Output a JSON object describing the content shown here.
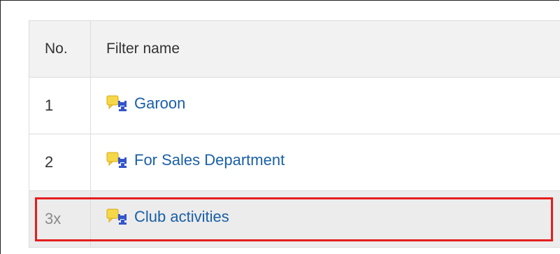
{
  "table": {
    "headers": {
      "no": "No.",
      "filter_name": "Filter name"
    },
    "rows": [
      {
        "no": "1",
        "name": "Garoon",
        "selected": false
      },
      {
        "no": "2",
        "name": "For Sales Department",
        "selected": false
      },
      {
        "no": "3x",
        "name": "Club activities",
        "selected": true
      }
    ]
  },
  "icons": {
    "filter": "filter-rule-icon"
  },
  "colors": {
    "link": "#1a5fa6",
    "highlight": "#e41e1e",
    "header_bg": "#f2f2f2",
    "selected_row_bg": "#ececec"
  }
}
